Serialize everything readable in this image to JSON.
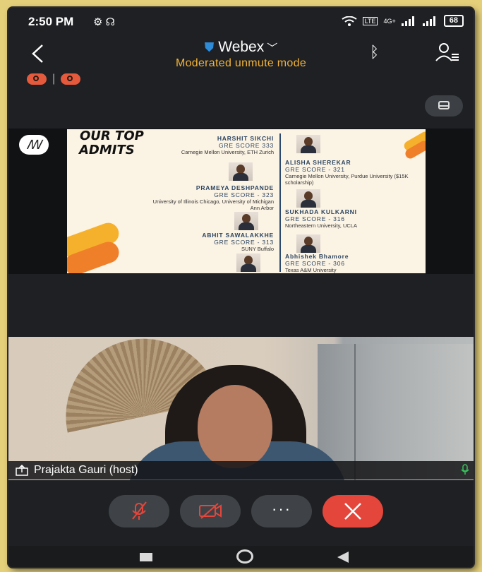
{
  "status_bar": {
    "time": "2:50 PM",
    "left_icons": "⚙ ☊",
    "network": "4G+",
    "volte": "LTE",
    "battery": "68"
  },
  "header": {
    "app_name": "Webex",
    "subtitle": "Moderated unmute mode",
    "colors": {
      "subtitle": "#f1b23a",
      "shield": "#2e8bd8"
    }
  },
  "slide": {
    "title_line1": "OUR TOP",
    "title_line2": "ADMITS",
    "entries_left": [
      {
        "name": "HARSHIT SIKCHI",
        "score": "GRE SCORE 333",
        "detail": "Carnegie Mellon University, ETH Zurich"
      },
      {
        "name": "PRAMEYA DESHPANDE",
        "score": "GRE SCORE - 323",
        "detail": "University of Illinois Chicago, University of Michigan Ann Arbor"
      },
      {
        "name": "ABHIT SAWALAKKHE",
        "score": "GRE SCORE - 313",
        "detail": "SUNY Buffalo"
      }
    ],
    "entries_right": [
      {
        "name": "ALISHA SHEREKAR",
        "score": "GRE SCORE - 321",
        "detail": "Carnegie Mellon University, Purdue University ($15K scholarship)"
      },
      {
        "name": "SUKHADA KULKARNI",
        "score": "GRE SCORE - 316",
        "detail": "Northeastern University, UCLA"
      },
      {
        "name": "Abhishek Bhamore",
        "score": "GRE SCORE - 306",
        "detail": "Texas A&M University"
      }
    ]
  },
  "video": {
    "participant_name": "Prajakta Gauri (host)"
  },
  "controls": {
    "more_label": "···",
    "end_color": "#e5463b"
  }
}
